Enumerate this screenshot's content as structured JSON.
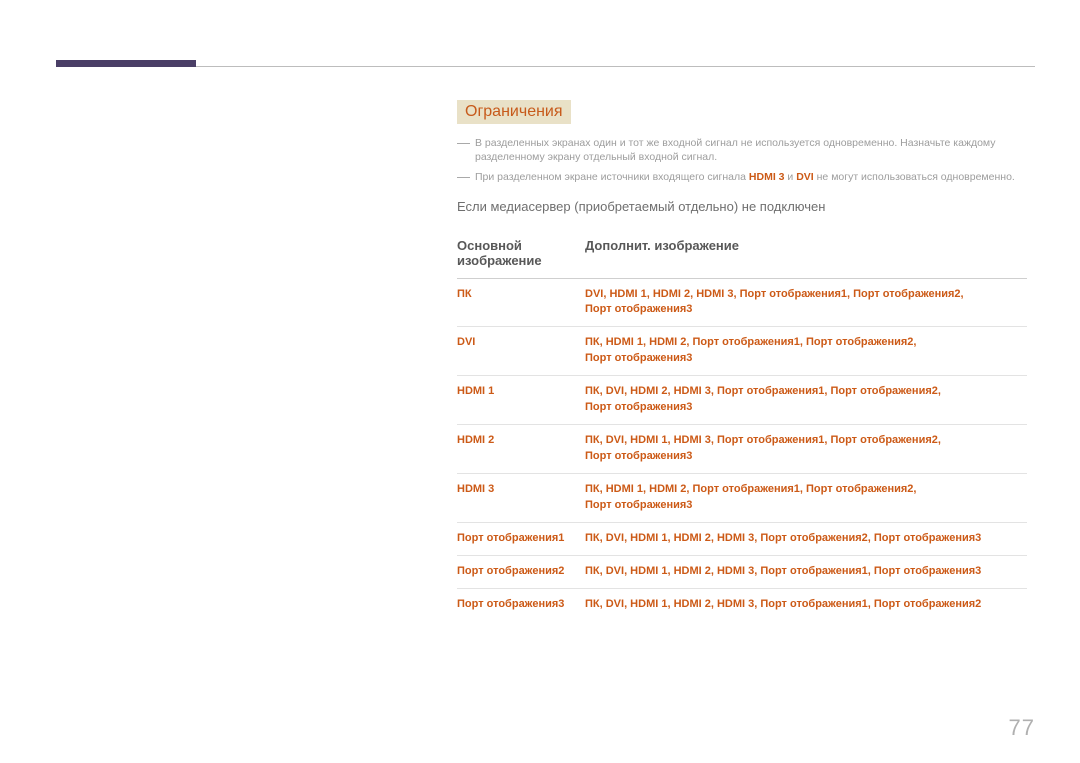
{
  "section_title": "Ограничения",
  "bullets": [
    {
      "pre": "В разделенных экранах один и тот же входной сигнал не используется одновременно. Назначьте каждому разделенному экрану отдельный входной сигнал."
    },
    {
      "pre": "При разделенном экране источники входящего сигнала ",
      "hl1": "HDMI 3",
      "mid": " и ",
      "hl2": "DVI",
      "post": " не могут использоваться одновременно."
    }
  ],
  "condition": "Если медиасервер (приобретаемый отдельно) не подключен",
  "table_headers": {
    "col1_line1": "Основной",
    "col1_line2": "изображение",
    "col2": "Дополнит. изображение"
  },
  "rows": [
    {
      "src": "ПК",
      "dst_l1": "DVI, HDMI 1, HDMI 2, HDMI 3, Порт отображения1, Порт отображения2,",
      "dst_l2": "Порт отображения3"
    },
    {
      "src": "DVI",
      "dst_l1": "ПК, HDMI 1, HDMI 2, Порт отображения1, Порт отображения2,",
      "dst_l2": "Порт отображения3"
    },
    {
      "src": "HDMI 1",
      "dst_l1": "ПК, DVI, HDMI 2, HDMI 3, Порт отображения1, Порт отображения2,",
      "dst_l2": "Порт отображения3"
    },
    {
      "src": "HDMI 2",
      "dst_l1": "ПК, DVI, HDMI 1, HDMI 3, Порт отображения1, Порт отображения2,",
      "dst_l2": "Порт отображения3"
    },
    {
      "src": "HDMI 3",
      "dst_l1": "ПК, HDMI 1, HDMI 2, Порт отображения1, Порт отображения2,",
      "dst_l2": "Порт отображения3"
    },
    {
      "src": "Порт отображения1",
      "dst_l1": "ПК, DVI, HDMI 1, HDMI 2, HDMI 3, Порт отображения2, Порт отображения3",
      "dst_l2": ""
    },
    {
      "src": "Порт отображения2",
      "dst_l1": "ПК, DVI, HDMI 1, HDMI 2, HDMI 3, Порт отображения1, Порт отображения3",
      "dst_l2": ""
    },
    {
      "src": "Порт отображения3",
      "dst_l1": "ПК, DVI, HDMI 1, HDMI 2, HDMI 3, Порт отображения1, Порт отображения2",
      "dst_l2": ""
    }
  ],
  "page_number": "77"
}
